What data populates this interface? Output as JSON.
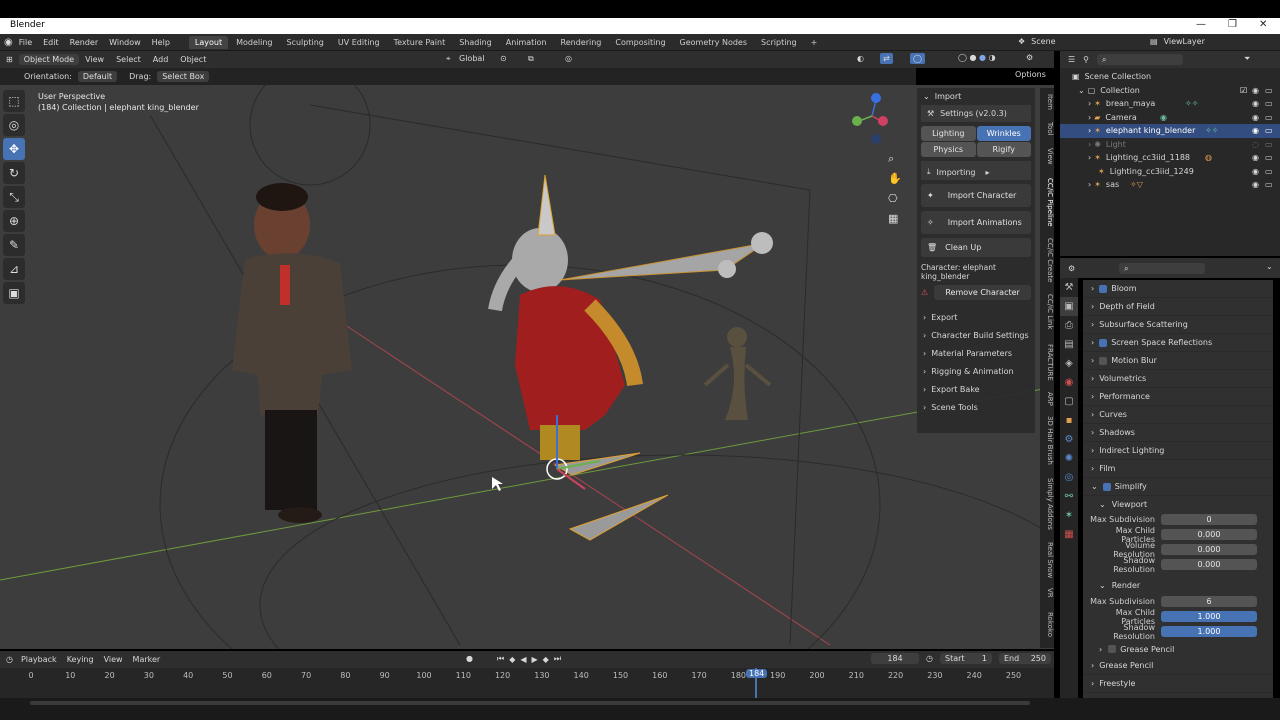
{
  "window": {
    "title": "Blender",
    "controls": [
      "—",
      "❐",
      "✕"
    ]
  },
  "menu": [
    "File",
    "Edit",
    "Render",
    "Window",
    "Help"
  ],
  "workspaces": [
    "Layout",
    "Modeling",
    "Sculpting",
    "UV Editing",
    "Texture Paint",
    "Shading",
    "Animation",
    "Rendering",
    "Compositing",
    "Geometry Nodes",
    "Scripting"
  ],
  "active_workspace": "Layout",
  "scene": "Scene",
  "view_layer": "ViewLayer",
  "viewport_header": {
    "mode": "Object Mode",
    "menus": [
      "View",
      "Select",
      "Add",
      "Object"
    ],
    "transform_orientation": "Global",
    "orientation_label": "Orientation:",
    "orientation_value": "Default",
    "drag_label": "Drag:",
    "drag_value": "Select Box",
    "options": "Options"
  },
  "viewport": {
    "perspective": "User Perspective",
    "collection_info": "(184) Collection | elephant king_blender"
  },
  "npanel": {
    "title": "Import",
    "settings": "Settings (v2.0.3)",
    "buttons_row1": [
      "Lighting",
      "Wrinkles"
    ],
    "buttons_row2": [
      "Physics",
      "Rigify"
    ],
    "importing": "Importing",
    "import_character": "Import Character",
    "import_animations": "Import Animations",
    "clean_up": "Clean Up",
    "character": "Character: elephant king_blender",
    "remove_character": "Remove Character",
    "sections": [
      "Export",
      "Character Build Settings",
      "Material Parameters",
      "Rigging & Animation",
      "Export Bake",
      "Scene Tools"
    ],
    "tabs": [
      "Item",
      "Tool",
      "View",
      "CC/iC Pipeline",
      "CC/iC Create",
      "CC/iC Link",
      "FRACTURE",
      "ARP",
      "3D Hair Brush",
      "Simply Addons",
      "Real Snow",
      "VR",
      "Rokoko"
    ]
  },
  "outliner": {
    "root": "Scene Collection",
    "collection": "Collection",
    "items": [
      {
        "name": "brean_maya",
        "state": "normal"
      },
      {
        "name": "Camera",
        "state": "normal"
      },
      {
        "name": "elephant king_blender",
        "state": "selected"
      },
      {
        "name": "Light",
        "state": "dim"
      },
      {
        "name": "Lighting_cc3iid_1188",
        "state": "normal"
      },
      {
        "name": "Lighting_cc3iid_1249",
        "state": "normal"
      },
      {
        "name": "sas",
        "state": "normal"
      }
    ]
  },
  "properties": {
    "sections": [
      {
        "label": "Bloom",
        "checkbox": "on"
      },
      {
        "label": "Depth of Field",
        "checkbox": "none"
      },
      {
        "label": "Subsurface Scattering",
        "checkbox": "none"
      },
      {
        "label": "Screen Space Reflections",
        "checkbox": "on"
      },
      {
        "label": "Motion Blur",
        "checkbox": "off"
      },
      {
        "label": "Volumetrics",
        "checkbox": "none"
      },
      {
        "label": "Performance",
        "checkbox": "none"
      },
      {
        "label": "Curves",
        "checkbox": "none"
      },
      {
        "label": "Shadows",
        "checkbox": "none"
      },
      {
        "label": "Indirect Lighting",
        "checkbox": "none"
      },
      {
        "label": "Film",
        "checkbox": "none"
      },
      {
        "label": "Simplify",
        "checkbox": "on"
      }
    ],
    "viewport_label": "Viewport",
    "viewport_fields": [
      {
        "label": "Max Subdivision",
        "value": "0",
        "highlight": false
      },
      {
        "label": "Max Child Particles",
        "value": "0.000",
        "highlight": false
      },
      {
        "label": "Volume Resolution",
        "value": "0.000",
        "highlight": false
      },
      {
        "label": "Shadow Resolution",
        "value": "0.000",
        "highlight": false
      }
    ],
    "render_label": "Render",
    "render_fields": [
      {
        "label": "Max Subdivision",
        "value": "6",
        "highlight": false
      },
      {
        "label": "Max Child Particles",
        "value": "1.000",
        "highlight": true
      },
      {
        "label": "Shadow Resolution",
        "value": "1.000",
        "highlight": true
      }
    ],
    "grease_pencil_sub": "Grease Pencil",
    "grease_pencil": "Grease Pencil",
    "freestyle": "Freestyle"
  },
  "timeline": {
    "menus": [
      "Playback",
      "Keying",
      "View",
      "Marker"
    ],
    "current_frame": "184",
    "start_label": "Start",
    "start": "1",
    "end_label": "End",
    "end": "250",
    "ticks": [
      "0",
      "10",
      "20",
      "30",
      "40",
      "50",
      "60",
      "70",
      "80",
      "90",
      "100",
      "110",
      "120",
      "130",
      "140",
      "150",
      "160",
      "170",
      "180",
      "190",
      "200",
      "210",
      "220",
      "230",
      "240",
      "250"
    ],
    "playhead": "184"
  },
  "colors": {
    "accent": "#4772b3",
    "selected_row": "#334d80",
    "viewport_bg": "#3d3d3d",
    "panel_bg": "#2b2b2b"
  }
}
